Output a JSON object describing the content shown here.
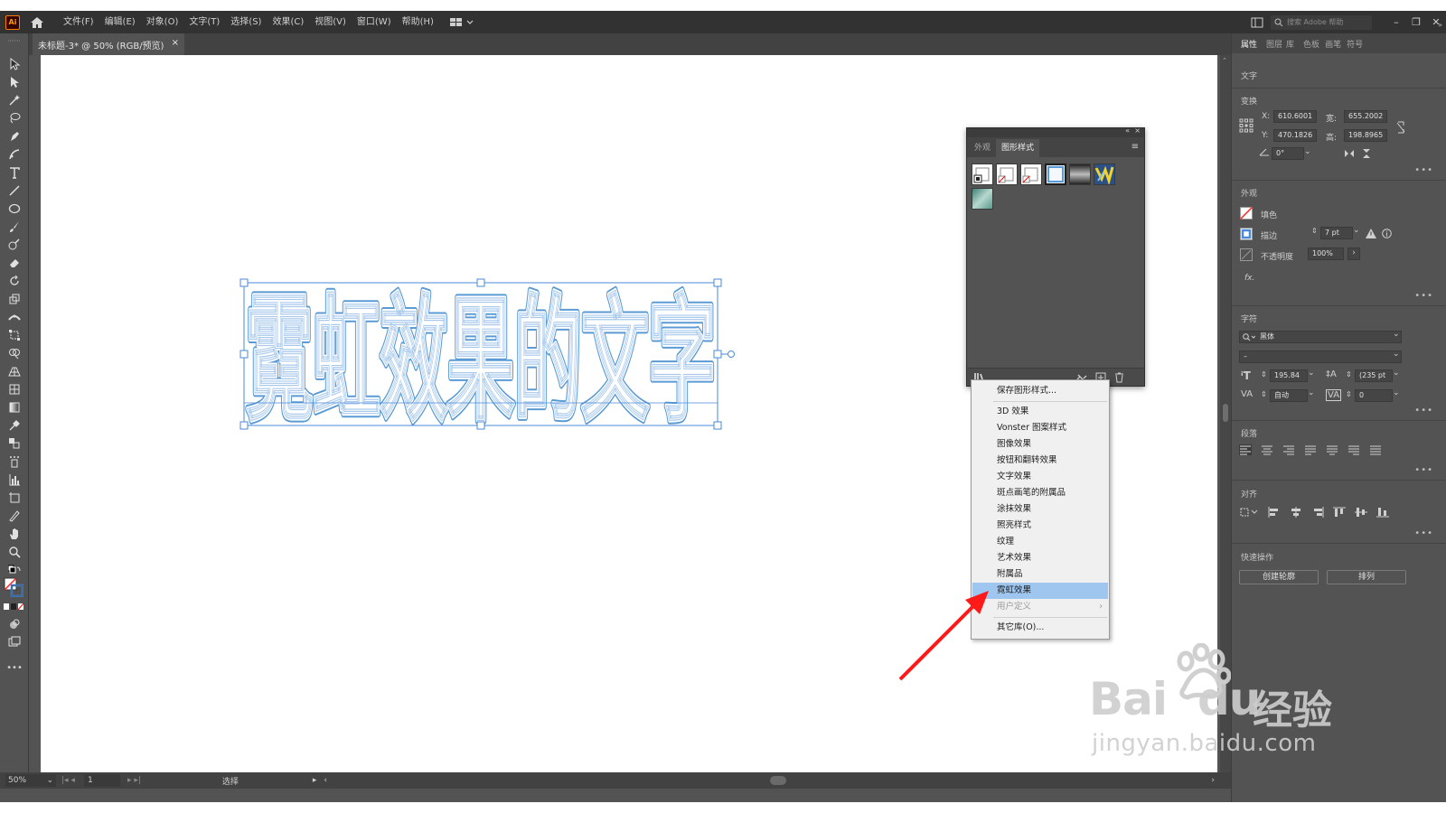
{
  "menubar": {
    "logo": "Ai",
    "items": [
      "文件(F)",
      "编辑(E)",
      "对象(O)",
      "文字(T)",
      "选择(S)",
      "效果(C)",
      "视图(V)",
      "窗口(W)",
      "帮助(H)"
    ],
    "search_placeholder": "搜索 Adobe 帮助"
  },
  "document_tab": {
    "title": "未标题-3* @ 50% (RGB/预览)",
    "close": "×"
  },
  "artwork": {
    "text": "霓虹效果的文字",
    "stroke_color": "#5b9bd5",
    "inner_color": "#a8c9ec"
  },
  "statusbar": {
    "zoom": "50%",
    "page": "1",
    "mode": "选择"
  },
  "properties": {
    "tabs": [
      "属性",
      "图层",
      "库",
      "色板",
      "画笔",
      "符号"
    ],
    "section_type": "文字",
    "transform": {
      "label": "变换",
      "x_label": "X:",
      "x": "610.6001",
      "y_label": "Y:",
      "y": "470.1826",
      "w_label": "宽:",
      "w": "655.2002",
      "h_label": "高:",
      "h": "198.8965",
      "angle": "0°"
    },
    "appearance": {
      "label": "外观",
      "fill_label": "填色",
      "stroke_label": "描边",
      "stroke_value": "7 pt",
      "opacity_label": "不透明度",
      "opacity_value": "100%",
      "fx_label": "fx."
    },
    "character": {
      "label": "字符",
      "font": "黑体",
      "style": "–",
      "size": "195.84",
      "leading": "(235 pt",
      "kerning": "自动",
      "tracking": "0"
    },
    "paragraph_label": "段落",
    "align_label": "对齐",
    "quick_actions": {
      "label": "快速操作",
      "create_outlines": "创建轮廓",
      "arrange": "排列"
    },
    "more": "•••"
  },
  "graphic_styles_panel": {
    "tabs": [
      "外观",
      "图形样式"
    ],
    "swatch_names": [
      "default",
      "no-fill-1",
      "no-fill-2",
      "blue-outline",
      "gray-gradient",
      "yellow-blue-pattern",
      "teal-texture"
    ]
  },
  "popup_menu": {
    "items": [
      {
        "label": "保存图形样式...",
        "state": "normal"
      },
      {
        "label": "3D 效果",
        "state": "normal"
      },
      {
        "label": "Vonster 图案样式",
        "state": "normal"
      },
      {
        "label": "图像效果",
        "state": "normal"
      },
      {
        "label": "按钮和翻转效果",
        "state": "normal"
      },
      {
        "label": "文字效果",
        "state": "normal"
      },
      {
        "label": "斑点画笔的附属品",
        "state": "normal"
      },
      {
        "label": "涂抹效果",
        "state": "normal"
      },
      {
        "label": "照亮样式",
        "state": "normal"
      },
      {
        "label": "纹理",
        "state": "normal"
      },
      {
        "label": "艺术效果",
        "state": "normal"
      },
      {
        "label": "附属品",
        "state": "normal"
      },
      {
        "label": "霓虹效果",
        "state": "selected"
      },
      {
        "label": "用户定义",
        "state": "disabled"
      },
      {
        "label": "其它库(O)...",
        "state": "normal"
      }
    ],
    "submenu_arrow": "›"
  },
  "watermark": {
    "brand_latin": "Bai",
    "brand_du": "du",
    "brand_cn": "经验",
    "url": "jingyan.baidu.com"
  },
  "colors": {
    "app_bg": "#535353",
    "menubar_bg": "#323232",
    "selection_blue": "#4a8ad8",
    "menu_highlight": "#9ec6ee",
    "arrow_red": "#ff1a1a"
  }
}
